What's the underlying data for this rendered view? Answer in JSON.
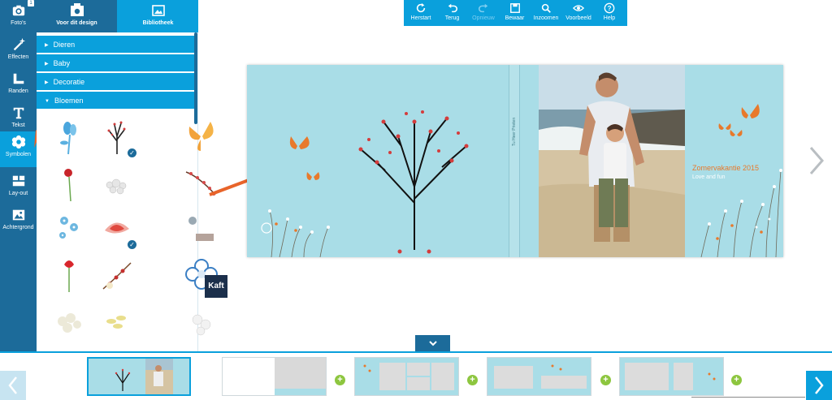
{
  "rail": {
    "photos": {
      "label": "Foto's",
      "badge": "1",
      "icon": "camera-icon"
    },
    "effects": {
      "label": "Effecten",
      "icon": "magic-wand-icon"
    },
    "borders": {
      "label": "Randen",
      "icon": "border-icon"
    },
    "text": {
      "label": "Tekst",
      "icon": "text-icon"
    },
    "symbols": {
      "label": "Symbolen",
      "icon": "flower-icon"
    },
    "layout": {
      "label": "Lay-out",
      "icon": "layout-icon"
    },
    "background": {
      "label": "Achtergrond",
      "icon": "image-icon"
    }
  },
  "panel": {
    "tabs": [
      {
        "label": "Voor dit design",
        "icon": "design-icon",
        "active": true
      },
      {
        "label": "Bibliotheek",
        "icon": "library-icon",
        "active": false
      }
    ],
    "categories": [
      {
        "label": "Dieren",
        "expanded": false
      },
      {
        "label": "Baby",
        "expanded": false
      },
      {
        "label": "Decoratie",
        "expanded": false
      },
      {
        "label": "Bloemen",
        "expanded": true
      }
    ]
  },
  "toolbar": {
    "items": [
      {
        "label": "Herstart",
        "icon": "refresh-icon",
        "enabled": true
      },
      {
        "label": "Terug",
        "icon": "undo-icon",
        "enabled": true
      },
      {
        "label": "Opnieuw",
        "icon": "redo-icon",
        "enabled": false
      },
      {
        "label": "Bewaar",
        "icon": "save-icon",
        "enabled": true
      },
      {
        "label": "Inzoomen",
        "icon": "zoom-icon",
        "enabled": true
      },
      {
        "label": "Voorbeeld",
        "icon": "eye-icon",
        "enabled": true
      },
      {
        "label": "Help",
        "icon": "help-icon",
        "enabled": true
      }
    ]
  },
  "cover": {
    "spine_text": "Tu Heer Prieten",
    "title": "Zomervakantie 2015",
    "subtitle": "Love and fun"
  },
  "page_label": "Kaft",
  "colors": {
    "accent": "#0aa0dc",
    "dark": "#1c6b9a",
    "cover_bg": "#a9dde7",
    "orange": "#e8792b",
    "plus_green": "#8dc63f"
  }
}
